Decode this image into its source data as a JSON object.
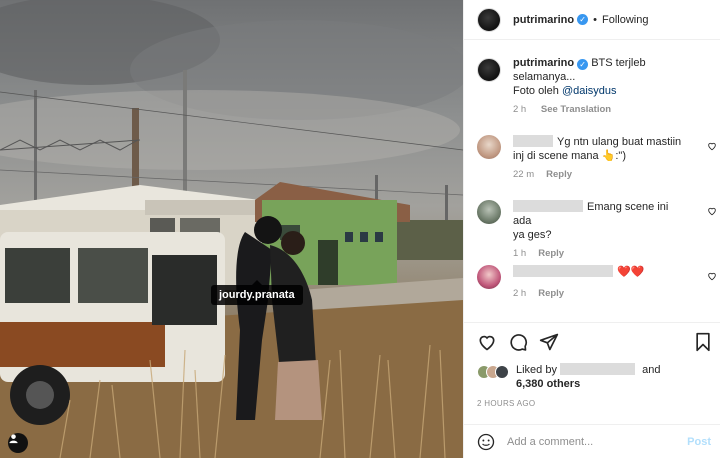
{
  "photo": {
    "tag_label": "jourdy.pranata"
  },
  "header": {
    "username": "putrimarino",
    "separator": "•",
    "follow_status": "Following"
  },
  "caption": {
    "username": "putrimarino",
    "text_line1": "BTS terjleb",
    "text_line2": "selamanya...",
    "text_line3": "Foto oleh",
    "mention": "@daisydus",
    "time": "2 h",
    "see_translation": "See Translation"
  },
  "comments": [
    {
      "text_line1": "Yg ntn ulang buat mastiin",
      "text_line2": "inj di scene mana 👆:\")",
      "time": "22 m",
      "reply": "Reply"
    },
    {
      "text_line1": "Emang scene ini ada",
      "text_line2": "ya ges?",
      "time": "1 h",
      "reply": "Reply"
    },
    {
      "text_line1": "❤️❤️",
      "time": "2 h",
      "reply": "Reply"
    }
  ],
  "likes": {
    "prefix": "Liked by",
    "and": "and",
    "others": "6,380 others"
  },
  "time_ago": "2 HOURS AGO",
  "add_comment": {
    "placeholder": "Add a comment...",
    "post_label": "Post"
  },
  "colors": {
    "verified": "#3897f0",
    "mention": "#00376b",
    "post_disabled": "#b2dffc"
  },
  "icons": [
    "heart-icon",
    "comment-icon",
    "share-icon",
    "bookmark-icon",
    "emoji-icon",
    "user-tag-icon"
  ]
}
